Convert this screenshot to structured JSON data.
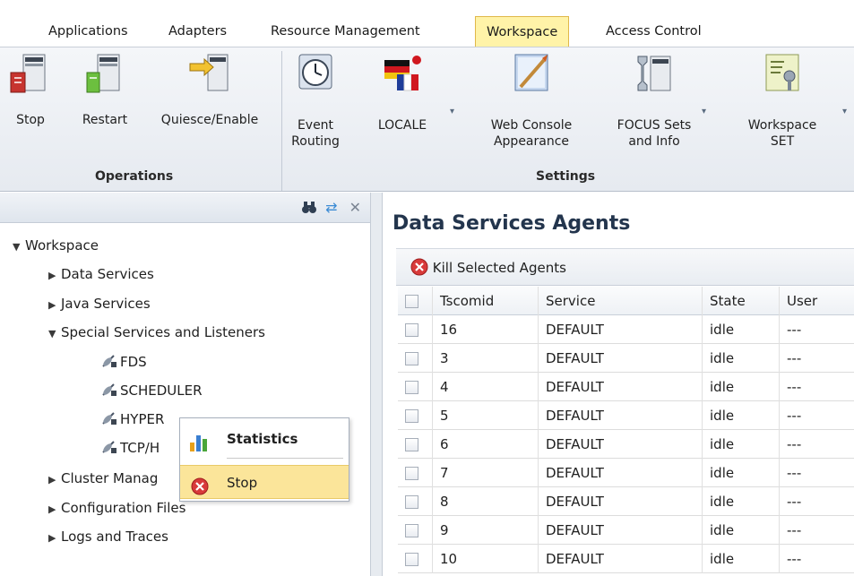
{
  "menubar": {
    "items": [
      {
        "label": "Applications",
        "active": false
      },
      {
        "label": "Adapters",
        "active": false
      },
      {
        "label": "Resource Management",
        "active": false
      },
      {
        "label": "Workspace",
        "active": true
      },
      {
        "label": "Access Control",
        "active": false
      }
    ]
  },
  "ribbon": {
    "groups": [
      {
        "label": "Operations"
      },
      {
        "label": "Settings"
      }
    ],
    "buttons": [
      {
        "label": "Stop",
        "icon": "server-stop-icon"
      },
      {
        "label": "Restart",
        "icon": "server-restart-icon"
      },
      {
        "label": "Quiesce/Enable",
        "icon": "server-quiesce-icon"
      },
      {
        "label": "Event\nRouting",
        "icon": "clock-icon"
      },
      {
        "label": "LOCALE",
        "icon": "flags-icon"
      },
      {
        "label": "Web Console\nAppearance",
        "icon": "paint-icon"
      },
      {
        "label": "FOCUS Sets\nand Info",
        "icon": "focus-sets-icon"
      },
      {
        "label": "Workspace\nSET",
        "icon": "workspace-set-icon"
      }
    ]
  },
  "tree": {
    "root": "Workspace",
    "items": [
      {
        "label": "Data Services",
        "expanded": false
      },
      {
        "label": "Java Services",
        "expanded": false
      },
      {
        "label": "Special Services and Listeners",
        "expanded": true
      },
      {
        "label": "FDS",
        "leaf": true
      },
      {
        "label": "SCHEDULER",
        "leaf": true
      },
      {
        "label": "HYPER",
        "leaf": true
      },
      {
        "label": "TCP/H",
        "leaf": true
      },
      {
        "label": "Cluster Manag",
        "expanded": false
      },
      {
        "label": "Configuration Files",
        "expanded": false
      },
      {
        "label": "Logs and Traces",
        "expanded": false
      }
    ]
  },
  "context_menu": {
    "items": [
      {
        "label": "Statistics",
        "icon": "bar-chart-icon"
      },
      {
        "label": "Stop",
        "icon": "stop-icon"
      }
    ]
  },
  "main": {
    "title": "Data Services Agents",
    "toolbar": {
      "kill_label": "Kill Selected Agents"
    },
    "columns": [
      "Tscomid",
      "Service",
      "State",
      "User"
    ],
    "rows": [
      {
        "tscomid": "16",
        "service": "DEFAULT",
        "state": "idle",
        "user": "---"
      },
      {
        "tscomid": "3",
        "service": "DEFAULT",
        "state": "idle",
        "user": "---"
      },
      {
        "tscomid": "4",
        "service": "DEFAULT",
        "state": "idle",
        "user": "---"
      },
      {
        "tscomid": "5",
        "service": "DEFAULT",
        "state": "idle",
        "user": "---"
      },
      {
        "tscomid": "6",
        "service": "DEFAULT",
        "state": "idle",
        "user": "---"
      },
      {
        "tscomid": "7",
        "service": "DEFAULT",
        "state": "idle",
        "user": "---"
      },
      {
        "tscomid": "8",
        "service": "DEFAULT",
        "state": "idle",
        "user": "---"
      },
      {
        "tscomid": "9",
        "service": "DEFAULT",
        "state": "idle",
        "user": "---"
      },
      {
        "tscomid": "10",
        "service": "DEFAULT",
        "state": "idle",
        "user": "---"
      }
    ]
  },
  "colors": {
    "active_tab": "#fff3a8",
    "context_highlight": "#fbe59a",
    "title_text": "#23354d",
    "stop_red": "#d83a3a"
  }
}
